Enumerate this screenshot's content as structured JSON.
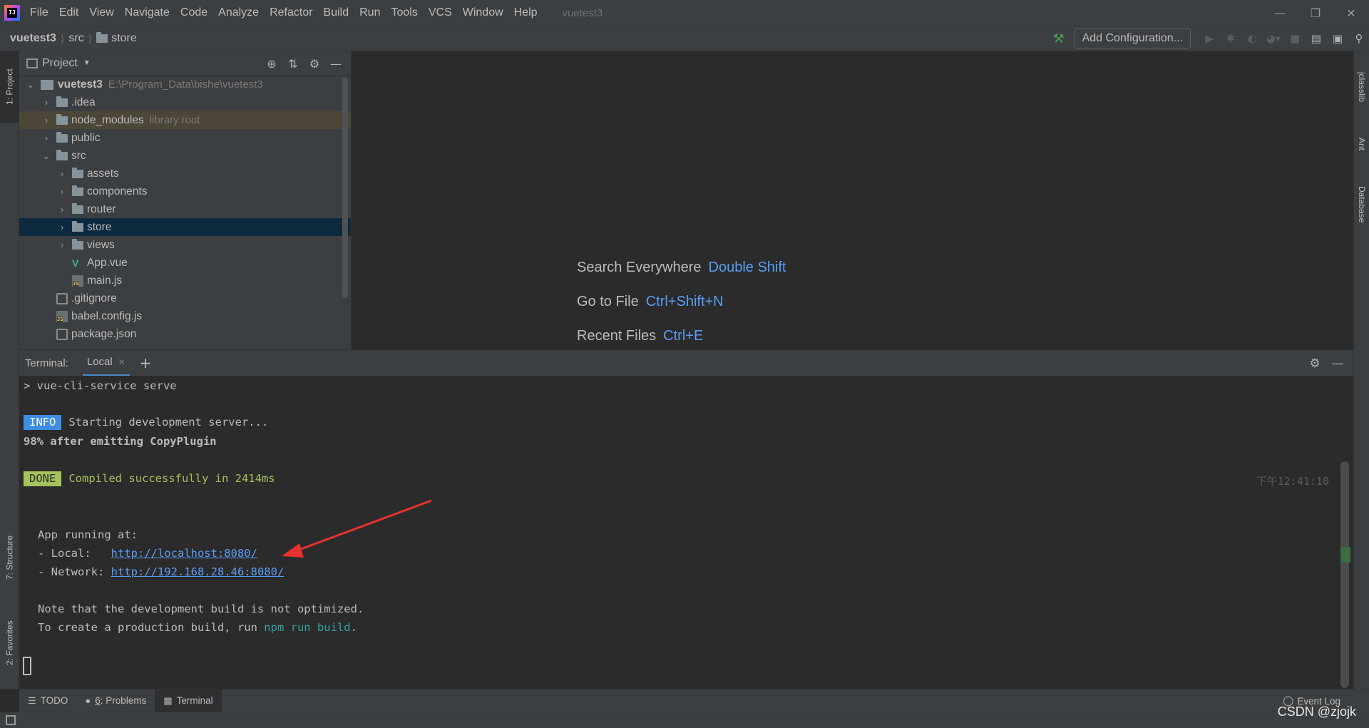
{
  "menubar": {
    "items": [
      "File",
      "Edit",
      "View",
      "Navigate",
      "Code",
      "Analyze",
      "Refactor",
      "Build",
      "Run",
      "Tools",
      "VCS",
      "Window",
      "Help"
    ],
    "project_name": "vuetest3"
  },
  "navbar": {
    "breadcrumbs": [
      "vuetest3",
      "src",
      "store"
    ],
    "add_configuration": "Add Configuration..."
  },
  "left_stripe": {
    "project_tab": "1: Project",
    "structure_tab": "7: Structure",
    "favorites_tab": "2: Favorites"
  },
  "right_stripe": {
    "tabs": [
      "jclasslib",
      "Ant",
      "Database"
    ]
  },
  "project_panel": {
    "title": "Project",
    "tree": [
      {
        "name": "vuetest3",
        "extra": "E:\\Program_Data\\bishe\\vuetest3"
      },
      {
        "name": ".idea"
      },
      {
        "name": "node_modules",
        "extra": "library root"
      },
      {
        "name": "public"
      },
      {
        "name": "src"
      },
      {
        "name": "assets"
      },
      {
        "name": "components"
      },
      {
        "name": "router"
      },
      {
        "name": "store"
      },
      {
        "name": "views"
      },
      {
        "name": "App.vue"
      },
      {
        "name": "main.js"
      },
      {
        "name": ".gitignore"
      },
      {
        "name": "babel.config.js"
      },
      {
        "name": "package.json"
      }
    ]
  },
  "editor": {
    "hints": [
      {
        "label": "Search Everywhere",
        "key": "Double Shift"
      },
      {
        "label": "Go to File",
        "key": "Ctrl+Shift+N"
      },
      {
        "label": "Recent Files",
        "key": "Ctrl+E"
      }
    ]
  },
  "terminal": {
    "label": "Terminal:",
    "tab": "Local",
    "lines": {
      "command": "> vue-cli-service serve",
      "info_badge": "INFO",
      "info_text": "Starting development server...",
      "progress": "98% after emitting CopyPlugin",
      "done_badge": "DONE",
      "done_text": "Compiled successfully in 2414ms",
      "timestamp": "下午12:41:10",
      "app_running": "App running at:",
      "local_label": "- Local:   ",
      "local_url": "http://localhost:8080/",
      "network_label": "- Network: ",
      "network_url": "http://192.168.28.46:8080/",
      "note": "Note that the development build is not optimized.",
      "prod_prefix": "To create a production build, run ",
      "prod_cmd": "npm run build",
      "prod_suffix": "."
    }
  },
  "bottom_tabs": {
    "todo": "TODO",
    "problems_num": "6",
    "problems": ": Problems",
    "terminal": "Terminal",
    "event_log": "Event Log"
  },
  "watermark": "CSDN @zjojk",
  "colors": {
    "accent_blue": "#589df6",
    "info_badge": "#3e8ce3",
    "done_badge": "#a5c25c",
    "annotation_arrow": "#e8322d"
  }
}
